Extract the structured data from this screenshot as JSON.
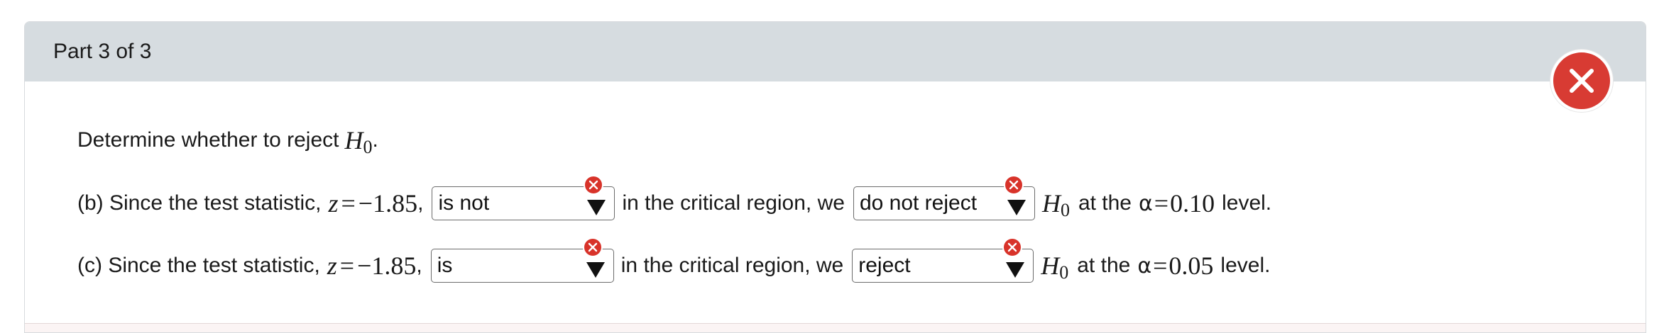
{
  "header": {
    "title": "Part 3 of 3"
  },
  "close_button": {
    "icon": "close-icon",
    "color": "#d83b33"
  },
  "prompt": {
    "text": "Determine whether to reject",
    "symbol": "H",
    "subscript": "0",
    "end": "."
  },
  "rows": [
    {
      "prefix": "(b) Since the test statistic,",
      "stat_var": "z",
      "stat_eq": "=",
      "stat_value": "−1.85",
      "comma": ",",
      "select1": {
        "value": "is not"
      },
      "middle": "in the critical region, we",
      "select2": {
        "value": "do not reject"
      },
      "h_symbol": "H",
      "h_sub": "0",
      "suffix_a": "at the",
      "alpha": "α",
      "alpha_eq": "=",
      "alpha_value": "0.10",
      "suffix_b": "level."
    },
    {
      "prefix": "(c) Since the test statistic,",
      "stat_var": "z",
      "stat_eq": "=",
      "stat_value": "−1.85",
      "comma": ",",
      "select1": {
        "value": "is"
      },
      "middle": "in the critical region, we",
      "select2": {
        "value": "reject"
      },
      "h_symbol": "H",
      "h_sub": "0",
      "suffix_a": "at the",
      "alpha": "α",
      "alpha_eq": "=",
      "alpha_value": "0.05",
      "suffix_b": "level."
    }
  ],
  "colors": {
    "header_bg": "#d6dce0",
    "error_badge": "#d8332a"
  }
}
